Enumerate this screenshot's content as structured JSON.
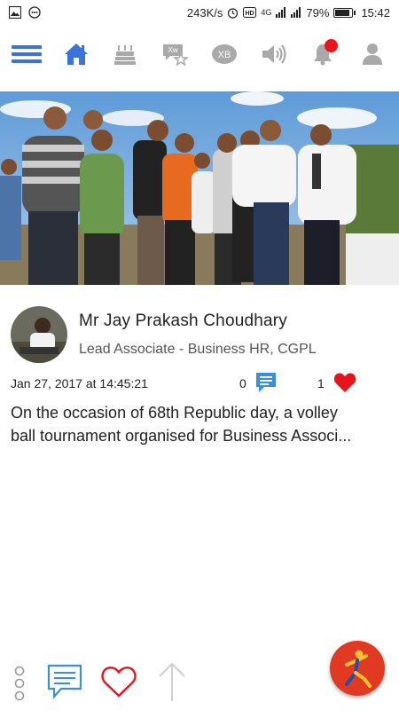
{
  "status_bar": {
    "net_speed": "243K/s",
    "network": "4G",
    "battery_percent": "79%",
    "battery_level": 0.79,
    "time": "15:42"
  },
  "nav": {
    "items": [
      "menu-icon",
      "home-icon",
      "birthday-cake-icon",
      "xw-star-icon",
      "xb-icon",
      "speaker-icon",
      "bell-icon",
      "user-icon"
    ],
    "accent": "#3d72d9",
    "inactive": "#a9a9a9",
    "notification_color": "#e8141b"
  },
  "post": {
    "author_name": "Mr Jay Prakash Choudhary",
    "author_role": "Lead Associate - Business HR, CGPL",
    "date": "Jan 27, 2017 at 14:45:21",
    "comment_count": "0",
    "like_count": "1",
    "text_line1": "On the occasion of 68th Republic day, a volley",
    "text_line2": "ball tournament organised for Business Associ..."
  },
  "bottom_bar": {
    "items": [
      "more-options-icon",
      "comment-icon",
      "heart-icon",
      "arrow-up-icon",
      "app-logo-fab"
    ],
    "fab_color": "#e23a22"
  }
}
